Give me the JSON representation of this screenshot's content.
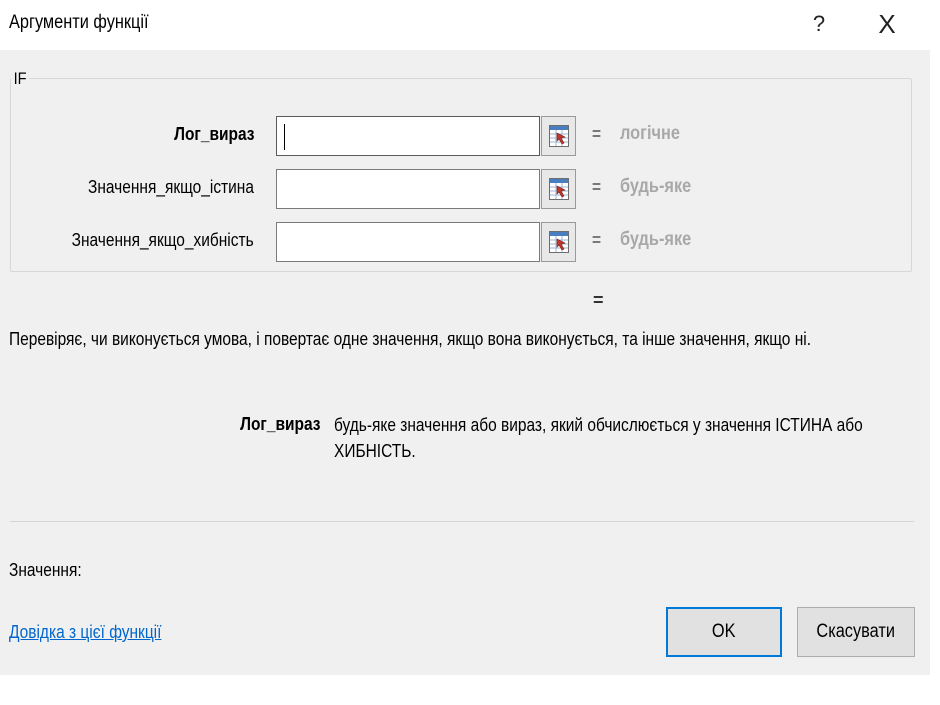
{
  "window": {
    "title": "Аргументи функції",
    "help_glyph": "?",
    "close_glyph": "X"
  },
  "group": {
    "function_name": "IF"
  },
  "arguments": [
    {
      "label": "Лог_вираз",
      "value": "",
      "result": "логічне",
      "bold": true
    },
    {
      "label": "Значення_якщо_істина",
      "value": "",
      "result": "будь-яке",
      "bold": false
    },
    {
      "label": "Значення_якщо_хибність",
      "value": "",
      "result": "будь-яке",
      "bold": false
    }
  ],
  "equals_sign": "=",
  "description": "Перевіряє, чи виконується умова, і повертає одне значення, якщо вона виконується, та інше значення, якщо ні.",
  "argument_help": {
    "name": "Лог_вираз",
    "text": "будь-яке значення або вираз, який обчислюється у значення ІСТИНА або ХИБНІСТЬ."
  },
  "result": {
    "label": "Значення:"
  },
  "footer": {
    "help_link": "Довідка з цієї функції",
    "ok_label": "OK",
    "cancel_label": "Скасувати"
  },
  "colors": {
    "dialog_background": "#f0f0f0",
    "titlebar_background": "#ffffff",
    "link": "#0066cc",
    "default_button_border": "#0078d7",
    "result_hint": "#a8a8a8"
  },
  "icons": {
    "help": "question-mark-icon",
    "close": "close-icon",
    "range_reference": "collapse-dialog-icon"
  }
}
